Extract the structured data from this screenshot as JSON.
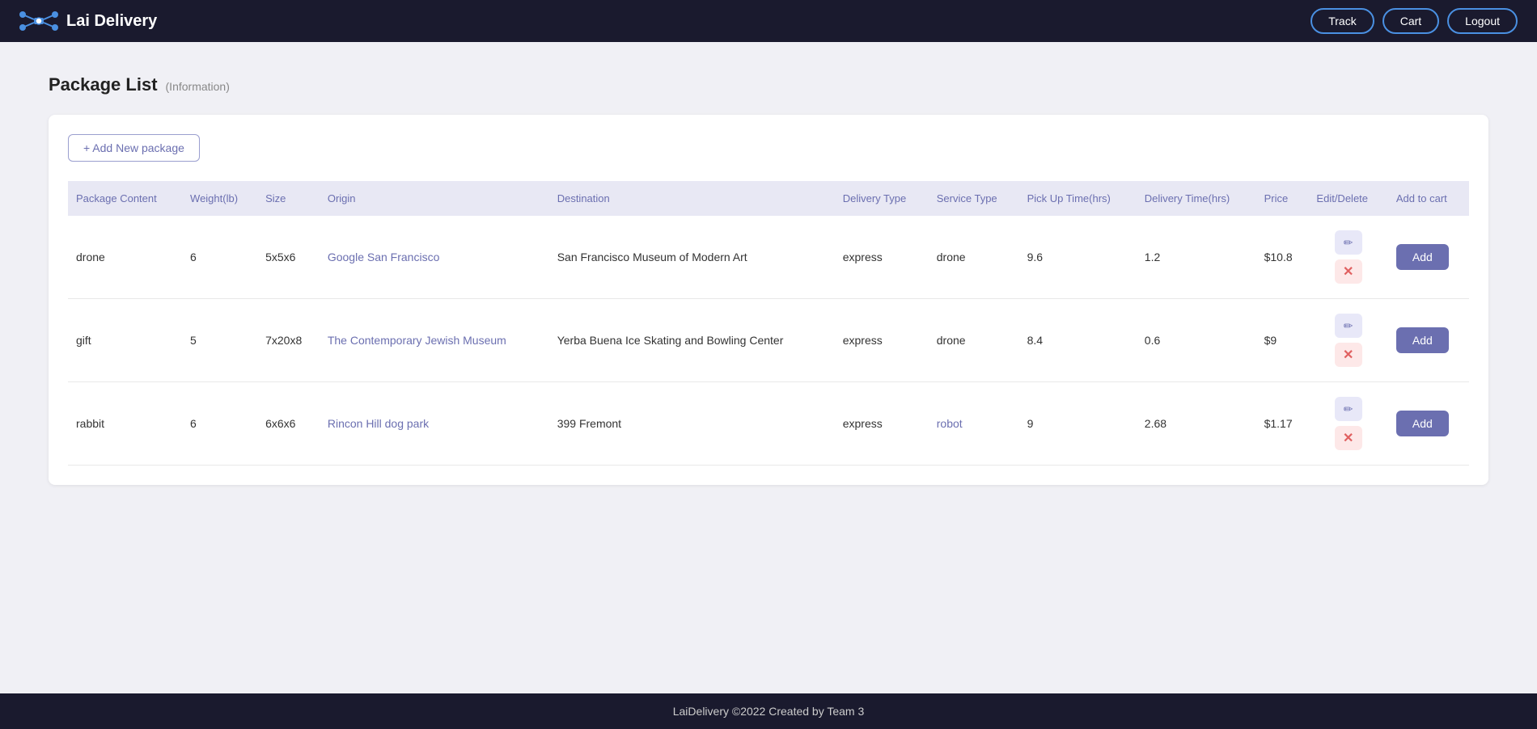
{
  "header": {
    "title": "Lai Delivery",
    "buttons": [
      {
        "label": "Track",
        "id": "track"
      },
      {
        "label": "Cart",
        "id": "cart"
      },
      {
        "label": "Logout",
        "id": "logout"
      }
    ]
  },
  "page": {
    "title": "Package List",
    "subtitle": "(Information)"
  },
  "add_package_btn": "+ Add New package",
  "table": {
    "headers": [
      "Package Content",
      "Weight(lb)",
      "Size",
      "Origin",
      "Destination",
      "Delivery Type",
      "Service Type",
      "Pick Up Time(hrs)",
      "Delivery Time(hrs)",
      "Price",
      "Edit/Delete",
      "Add to cart"
    ],
    "rows": [
      {
        "content": "drone",
        "weight": "6",
        "size": "5x5x6",
        "origin": "Google San Francisco",
        "origin_link": true,
        "destination": "San Francisco Museum of Modern Art",
        "delivery_type": "express",
        "service_type": "drone",
        "pickup_time": "9.6",
        "delivery_time": "1.2",
        "price": "$10.8",
        "add_label": "Add"
      },
      {
        "content": "gift",
        "weight": "5",
        "size": "7x20x8",
        "origin": "The Contemporary Jewish Museum",
        "origin_link": true,
        "destination": "Yerba Buena Ice Skating and Bowling Center",
        "delivery_type": "express",
        "service_type": "drone",
        "pickup_time": "8.4",
        "delivery_time": "0.6",
        "price": "$9",
        "add_label": "Add"
      },
      {
        "content": "rabbit",
        "weight": "6",
        "size": "6x6x6",
        "origin": "Rincon Hill dog park",
        "origin_link": true,
        "destination": "399 Fremont",
        "delivery_type": "express",
        "service_type": "robot",
        "pickup_time": "9",
        "delivery_time": "2.68",
        "price": "$1.17",
        "add_label": "Add"
      }
    ]
  },
  "footer": {
    "text": "LaiDelivery ©2022 Created by Team 3"
  },
  "icons": {
    "plus": "+",
    "edit": "✏",
    "delete": "✕"
  }
}
